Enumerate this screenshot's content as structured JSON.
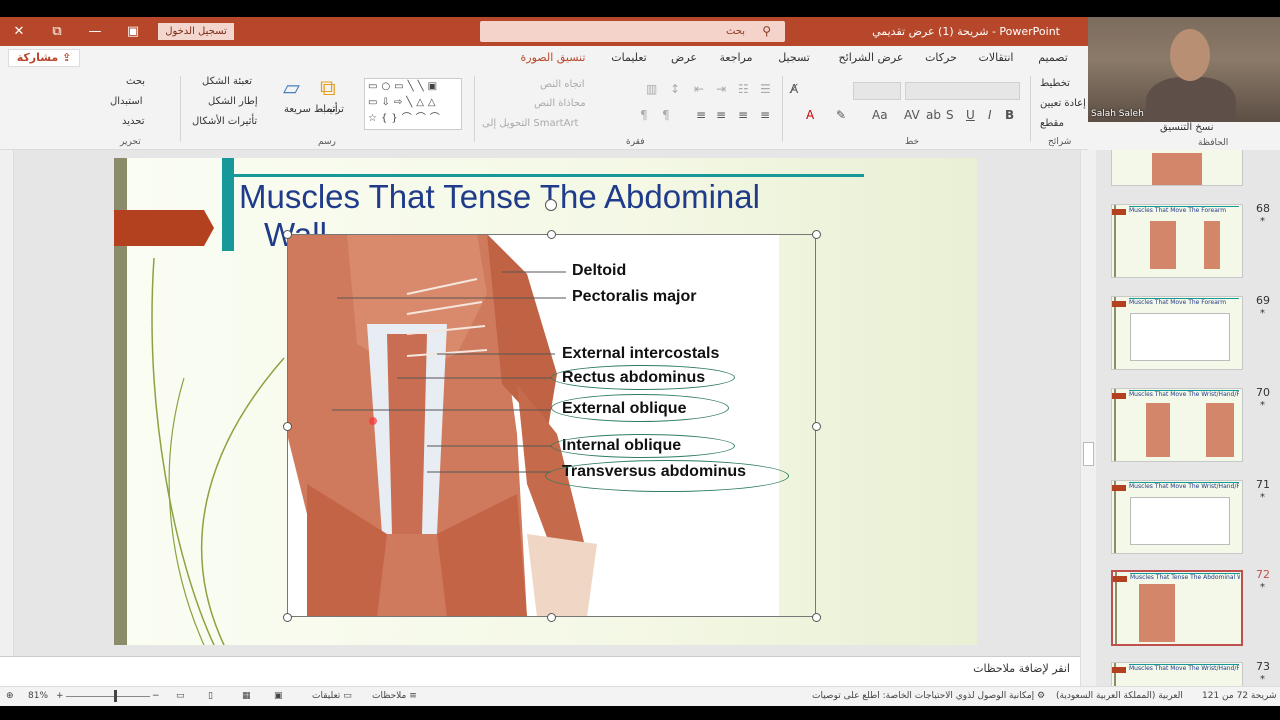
{
  "window": {
    "app_title": "شريحة (1) عرض تقديمي  -  PowerPoint",
    "sign_in": "تسجيل الدخول",
    "search_placeholder": "بحث",
    "controls": {
      "close": "✕",
      "restore": "⧉",
      "minimize": "—",
      "ribbon_opts": "▣"
    }
  },
  "menu": {
    "share": "مشاركة",
    "tabs": [
      "تصميم",
      "انتقالات",
      "حركات",
      "عرض الشرائح",
      "تسجيل",
      "مراجعة",
      "عرض",
      "تعليمات",
      "تنسيق الصورة"
    ]
  },
  "ribbon": {
    "slides": {
      "layout": "تخطيط",
      "reset": "إعادة تعيين",
      "section": "مقطع",
      "group": "شرائح"
    },
    "clipboard": {
      "format_painter": "نسخ التنسيق",
      "group": "الحافظة"
    },
    "font": {
      "group": "خط"
    },
    "paragraph": {
      "text_direction": "اتجاه النص",
      "align_text": "محاذاة النص",
      "smartart": "التحويل إلى SmartArt",
      "group": "فقرة"
    },
    "drawing": {
      "arrange": "ترتيب",
      "quick_styles": "أنماط سريعة",
      "shape_fill": "تعبئة الشكل",
      "shape_outline": "إطار الشكل",
      "shape_effects": "تأثيرات الأشكال",
      "group": "رسم"
    },
    "editing": {
      "find": "بحث",
      "replace": "استبدال",
      "select": "تحديد",
      "group": "تحرير"
    }
  },
  "camera": {
    "name": "Salah Saleh"
  },
  "thumbnails": [
    {
      "num": "",
      "title": "",
      "kind": "img"
    },
    {
      "num": "68",
      "title": "Muscles That Move The Forearm",
      "kind": "img"
    },
    {
      "num": "69",
      "title": "Muscles That Move The Forearm",
      "kind": "table"
    },
    {
      "num": "70",
      "title": "Muscles That Move The Wrist/Hand/Fingers",
      "kind": "img"
    },
    {
      "num": "71",
      "title": "Muscles That Move The Wrist/Hand/Fingers",
      "kind": "table"
    },
    {
      "num": "72",
      "title": "Muscles That Tense The Abdominal Wall",
      "kind": "img",
      "selected": true
    },
    {
      "num": "73",
      "title": "Muscles That Move The Wrist/Hand/Fingers",
      "kind": "img"
    }
  ],
  "slide": {
    "title_line1": "Muscles That Tense The Abdominal",
    "title_line2": "Wall",
    "labels": [
      "Deltoid",
      "Pectoralis major",
      "External intercostals",
      "Rectus abdominus",
      "External oblique",
      "Internal oblique",
      "Transversus abdominus"
    ]
  },
  "notes": {
    "placeholder": "انقر لإضافة ملاحظات"
  },
  "status": {
    "slide_counter": "شريحة 72 من 121",
    "language": "العربية (المملكة العربية السعودية)",
    "accessibility": "إمكانية الوصول لذوي الاحتياجات الخاصة: اطلع على توصيات",
    "notes": "ملاحظات",
    "comments": "تعليقات",
    "zoom": "81%"
  },
  "colors": {
    "accent": "#b7472a",
    "title_blue": "#1f3b8a",
    "teal": "#17999a",
    "selected_thumb": "#c0504d"
  }
}
